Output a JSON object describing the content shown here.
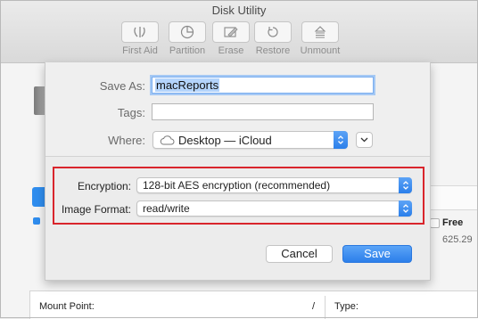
{
  "window": {
    "title": "Disk Utility"
  },
  "toolbar": [
    {
      "label": "First Aid",
      "icon": "first-aid-icon"
    },
    {
      "label": "Partition",
      "icon": "partition-icon"
    },
    {
      "label": "Erase",
      "icon": "erase-icon"
    },
    {
      "label": "Restore",
      "icon": "restore-icon"
    },
    {
      "label": "Unmount",
      "icon": "unmount-icon"
    }
  ],
  "background": {
    "free_label": "Free",
    "free_value": "625.29",
    "mount_point_label": "Mount Point:",
    "mount_point_value": "/",
    "type_label": "Type:"
  },
  "dialog": {
    "save_as_label": "Save As:",
    "save_as_value": "macReports",
    "tags_label": "Tags:",
    "tags_value": "",
    "where_label": "Where:",
    "where_value": "Desktop — iCloud",
    "where_icon": "icloud-icon",
    "encryption_label": "Encryption:",
    "encryption_value": "128-bit AES encryption (recommended)",
    "image_format_label": "Image Format:",
    "image_format_value": "read/write",
    "cancel_label": "Cancel",
    "save_label": "Save"
  },
  "colors": {
    "accent": "#2c7fea",
    "highlight_border": "#d9252c",
    "selection": "#b4d4fb"
  }
}
